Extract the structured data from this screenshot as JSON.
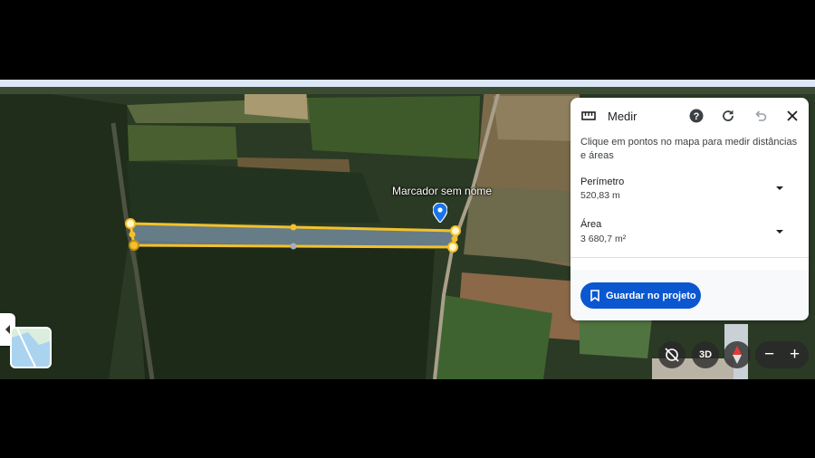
{
  "map": {
    "marker_label": "Marcador sem nome",
    "shape_color": "#f3c12b",
    "fill_color": "#8ea8c8"
  },
  "panel": {
    "title": "Medir",
    "instructions": "Clique em pontos no mapa para medir distâncias e áreas",
    "perimeter": {
      "label": "Perímetro",
      "value": "520,83 m"
    },
    "area": {
      "label": "Área",
      "value": "3 680,7 m²"
    },
    "save_label": "Guardar no projeto",
    "accent": "#0b57d0"
  },
  "controls": {
    "view_3d": "3D",
    "zoom_out": "−",
    "zoom_in": "+"
  }
}
